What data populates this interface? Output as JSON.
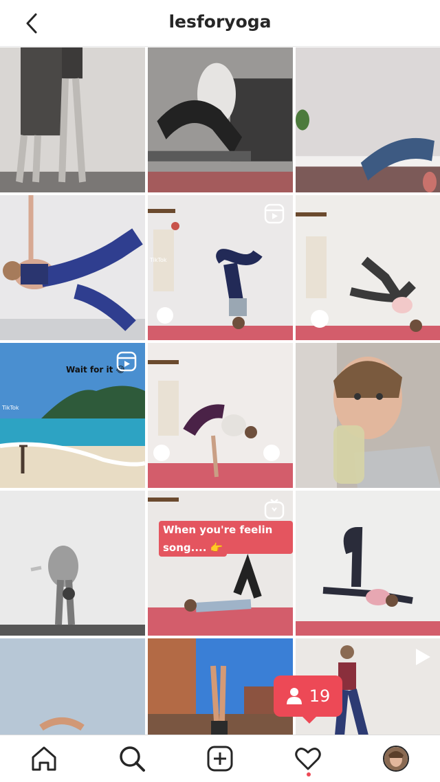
{
  "header": {
    "title": "lesforyoga",
    "back_icon": "chevron-left-icon"
  },
  "tiles": [
    {
      "row": 0,
      "col": 0,
      "kind": "photo"
    },
    {
      "row": 0,
      "col": 1,
      "kind": "photo"
    },
    {
      "row": 0,
      "col": 2,
      "kind": "photo"
    },
    {
      "row": 1,
      "col": 0,
      "kind": "photo"
    },
    {
      "row": 1,
      "col": 1,
      "kind": "reel",
      "tiktok": "TikTok"
    },
    {
      "row": 1,
      "col": 2,
      "kind": "photo"
    },
    {
      "row": 2,
      "col": 0,
      "kind": "reel",
      "overlay": "Wait for it 😂",
      "tiktok": "TikTok"
    },
    {
      "row": 2,
      "col": 1,
      "kind": "photo"
    },
    {
      "row": 2,
      "col": 2,
      "kind": "photo"
    },
    {
      "row": 3,
      "col": 0,
      "kind": "photo"
    },
    {
      "row": 3,
      "col": 1,
      "kind": "igtv",
      "caption_line1": "When you're feelin the",
      "caption_line2": "song.... 👉"
    },
    {
      "row": 3,
      "col": 2,
      "kind": "photo"
    },
    {
      "row": 4,
      "col": 0,
      "kind": "photo"
    },
    {
      "row": 4,
      "col": 1,
      "kind": "photo"
    },
    {
      "row": 4,
      "col": 2,
      "kind": "video"
    }
  ],
  "activity_badge": {
    "count": "19",
    "icon": "person-icon",
    "color": "#ed4956"
  },
  "nav": {
    "items": [
      "home-icon",
      "search-icon",
      "add-post-icon",
      "heart-icon",
      "profile-avatar"
    ]
  },
  "colors": {
    "accent": "#ed4956",
    "text": "#262626"
  }
}
